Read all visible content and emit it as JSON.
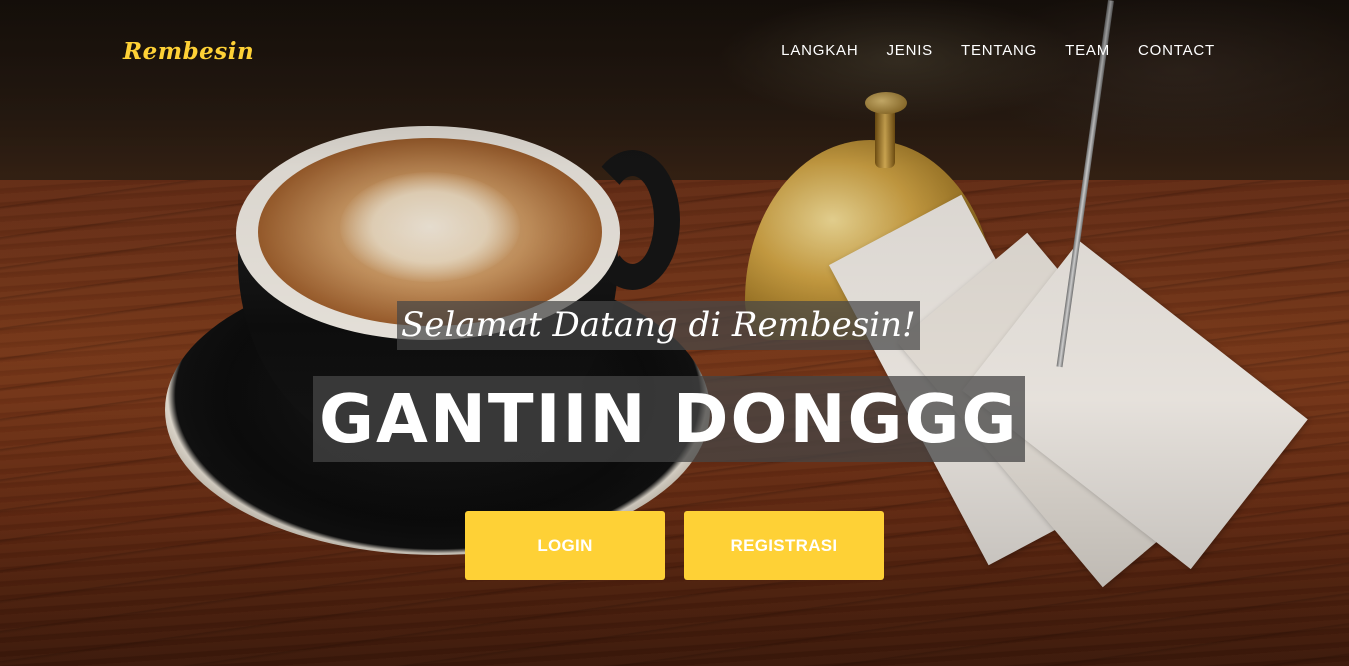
{
  "brand": {
    "name": "Rembesin",
    "color": "#fed136"
  },
  "nav": {
    "items": [
      {
        "label": "LANGKAH"
      },
      {
        "label": "JENIS"
      },
      {
        "label": "TENTANG"
      },
      {
        "label": "TEAM"
      },
      {
        "label": "CONTACT"
      }
    ]
  },
  "hero": {
    "lead": "Selamat Datang di Rembesin!",
    "heading": "GANTIIN DONGGG",
    "background": "coffee-cup-and-bell-photo",
    "buttons": {
      "login_label": "LOGIN",
      "register_label": "REGISTRASI",
      "color": "#fed136"
    }
  }
}
